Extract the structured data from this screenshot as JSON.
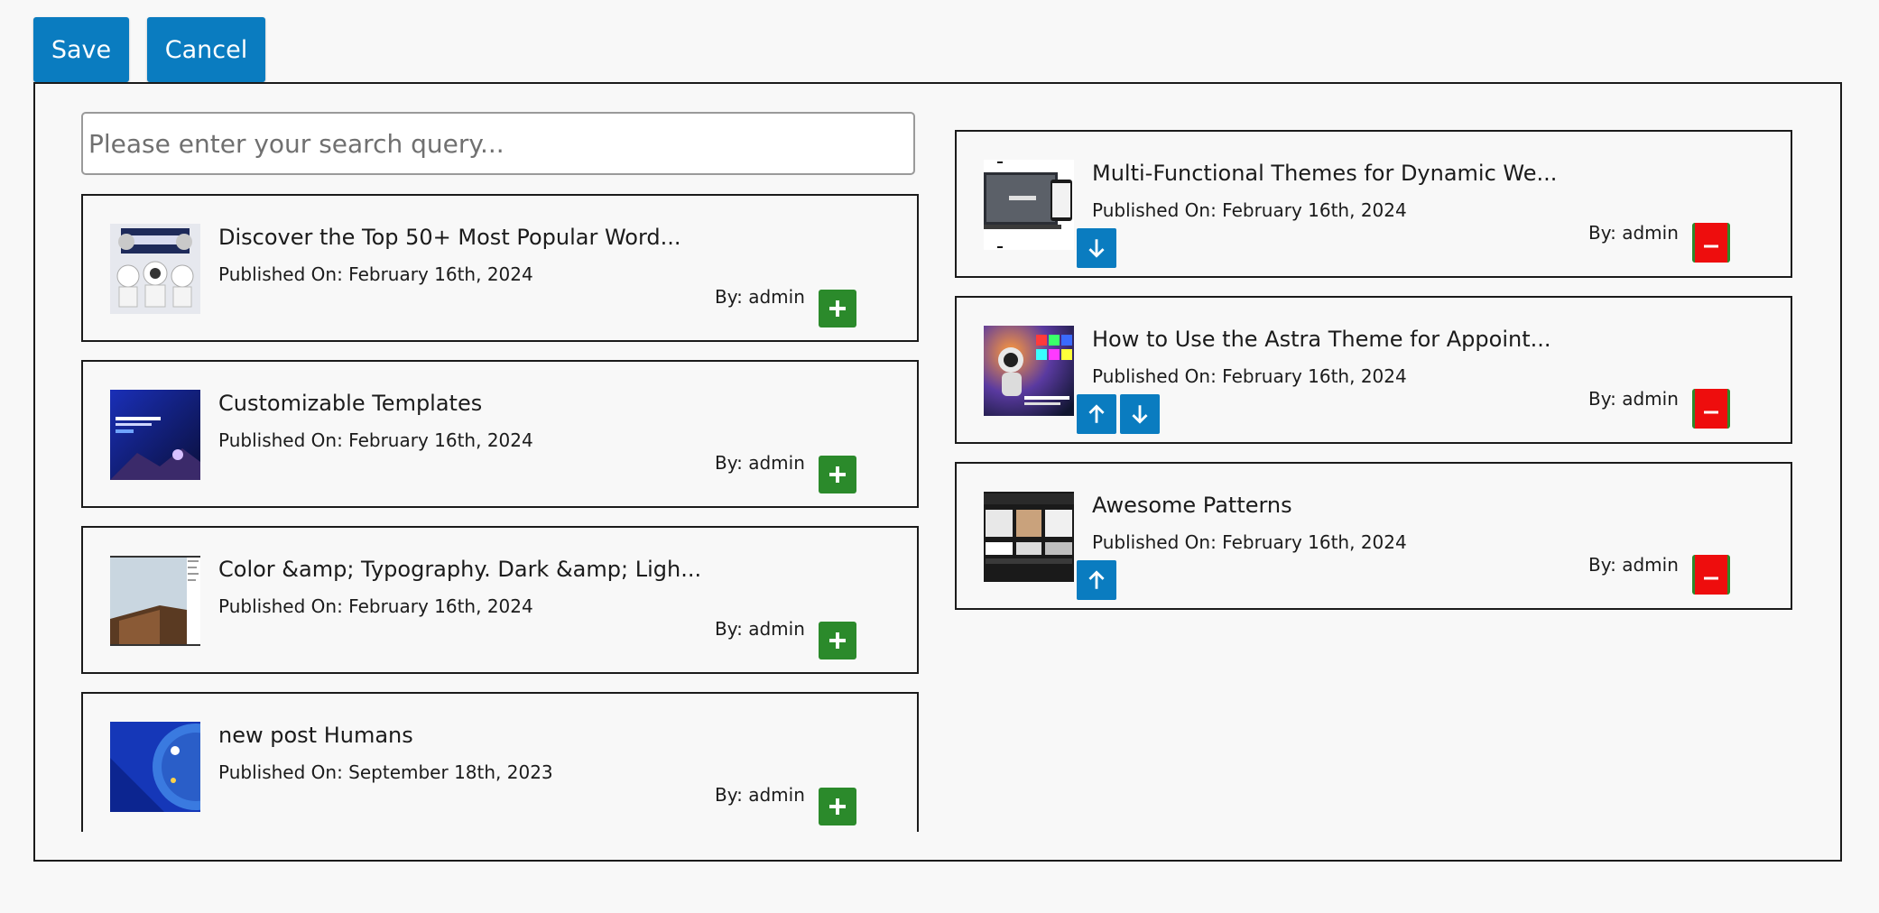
{
  "toolbar": {
    "save_label": "Save",
    "cancel_label": "Cancel"
  },
  "search": {
    "placeholder": "Please enter your search query..."
  },
  "colors": {
    "primary": "#0a7cc0",
    "add": "#2b8a2b",
    "remove": "#ee0d0d",
    "border": "#1b1b1b"
  },
  "available_posts": [
    {
      "title": "Discover the Top 50+ Most Popular Word...",
      "date": "Published On: February 16th, 2024",
      "author": "By: admin",
      "thumb_icon": "astronaut-robot-thumbnail"
    },
    {
      "title": "Customizable Templates",
      "date": "Published On: February 16th, 2024",
      "author": "By: admin",
      "thumb_icon": "blue-night-scene-thumbnail"
    },
    {
      "title": "Color &amp; Typography. Dark &amp; Ligh...",
      "date": "Published On: February 16th, 2024",
      "author": "By: admin",
      "thumb_icon": "building-sky-thumbnail"
    },
    {
      "title": "new post Humans",
      "date": "Published On: September 18th, 2023",
      "author": "By: admin",
      "thumb_icon": "blue-abstract-thumbnail"
    }
  ],
  "selected_posts": [
    {
      "title": "Multi-Functional Themes for Dynamic We...",
      "date": "Published On: February 16th, 2024",
      "author": "By: admin",
      "thumb_icon": "devices-mockup-thumbnail",
      "moves": [
        "down"
      ]
    },
    {
      "title": "How to Use the Astra Theme for Appoint...",
      "date": "Published On: February 16th, 2024",
      "author": "By: admin",
      "thumb_icon": "astronaut-lights-thumbnail",
      "moves": [
        "up",
        "down"
      ]
    },
    {
      "title": "Awesome Patterns",
      "date": "Published On: February 16th, 2024",
      "author": "By: admin",
      "thumb_icon": "pattern-grid-thumbnail",
      "moves": [
        "up"
      ]
    }
  ]
}
